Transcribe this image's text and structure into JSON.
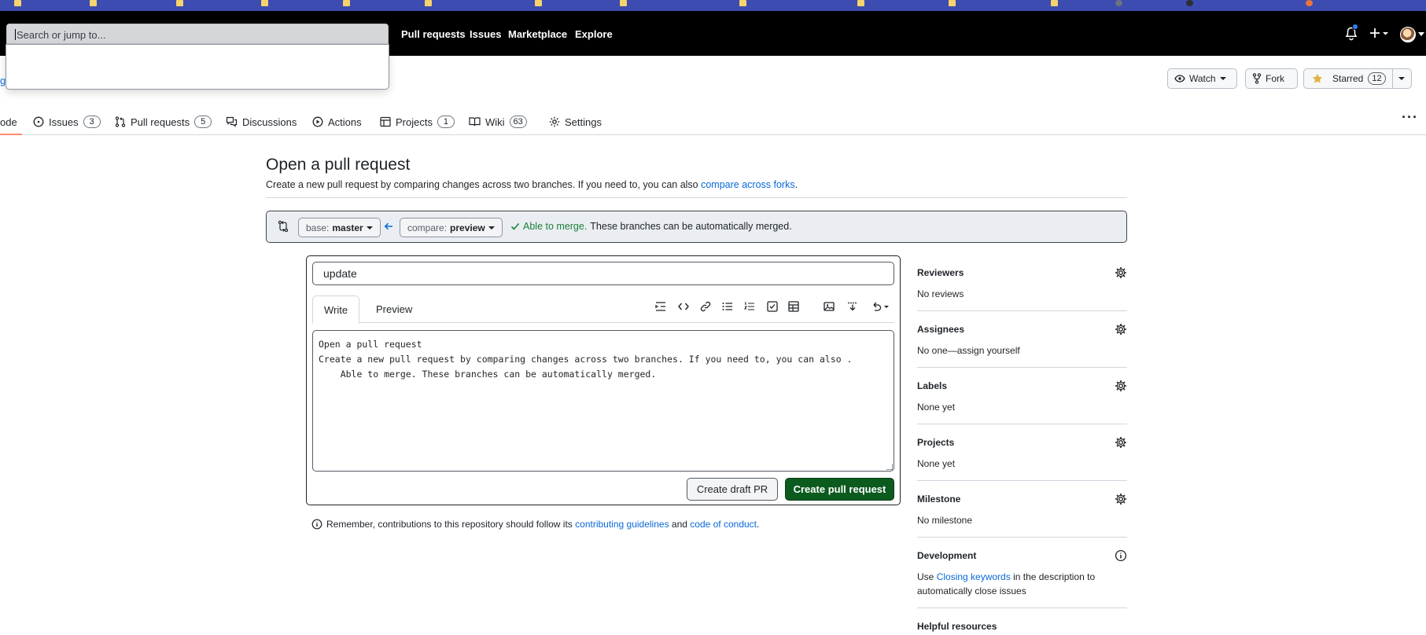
{
  "header": {
    "search_placeholder": "Search or jump to...",
    "nav": [
      "Pull requests",
      "Issues",
      "Marketplace",
      "Explore"
    ]
  },
  "breadcrumb_fragment": "g",
  "repo_actions": {
    "watch_label": "Watch",
    "fork_label": "Fork",
    "starred_label": "Starred",
    "star_count": "12"
  },
  "repo_tabs": [
    {
      "label": "ode",
      "icon": "code-icon"
    },
    {
      "label": "Issues",
      "count": "3",
      "icon": "issue-icon"
    },
    {
      "label": "Pull requests",
      "count": "5",
      "icon": "pull-request-icon"
    },
    {
      "label": "Discussions",
      "icon": "discussion-icon"
    },
    {
      "label": "Actions",
      "icon": "play-icon"
    },
    {
      "label": "Projects",
      "count": "1",
      "icon": "table-icon"
    },
    {
      "label": "Wiki",
      "count": "63",
      "icon": "book-icon"
    },
    {
      "label": "Settings",
      "icon": "gear-icon"
    }
  ],
  "page": {
    "title": "Open a pull request",
    "subtitle_prefix": "Create a new pull request by comparing changes across two branches. If you need to, you can also ",
    "subtitle_link": "compare across forks",
    "subtitle_suffix": "."
  },
  "compare": {
    "base_label": "base:",
    "base_value": "master",
    "compare_label": "compare:",
    "compare_value": "preview",
    "merge_status": "Able to merge.",
    "merge_detail": "These branches can be automatically merged."
  },
  "form": {
    "title_value": "update",
    "tab_write": "Write",
    "tab_preview": "Preview",
    "body_value": "Open a pull request\nCreate a new pull request by comparing changes across two branches. If you need to, you can also .\n    Able to merge. These branches can be automatically merged.",
    "draft_button": "Create draft PR",
    "create_button": "Create pull request"
  },
  "remember": {
    "prefix": "Remember, contributions to this repository should follow its ",
    "link1": "contributing guidelines",
    "middle": " and ",
    "link2": "code of conduct",
    "suffix": "."
  },
  "sidebar": {
    "reviewers": {
      "heading": "Reviewers",
      "value": "No reviews"
    },
    "assignees": {
      "heading": "Assignees",
      "value": "No one—assign yourself"
    },
    "labels": {
      "heading": "Labels",
      "value": "None yet"
    },
    "projects": {
      "heading": "Projects",
      "value": "None yet"
    },
    "milestone": {
      "heading": "Milestone",
      "value": "No milestone"
    },
    "development": {
      "heading": "Development",
      "prefix": "Use ",
      "link": "Closing keywords",
      "suffix": " in the description to automatically close issues"
    },
    "helpful": {
      "heading": "Helpful resources"
    }
  },
  "colors": {
    "header_bg": "#000000",
    "primary_green": "#0b5a1e",
    "link_blue": "#0969da",
    "success_green": "#1a7f37"
  }
}
